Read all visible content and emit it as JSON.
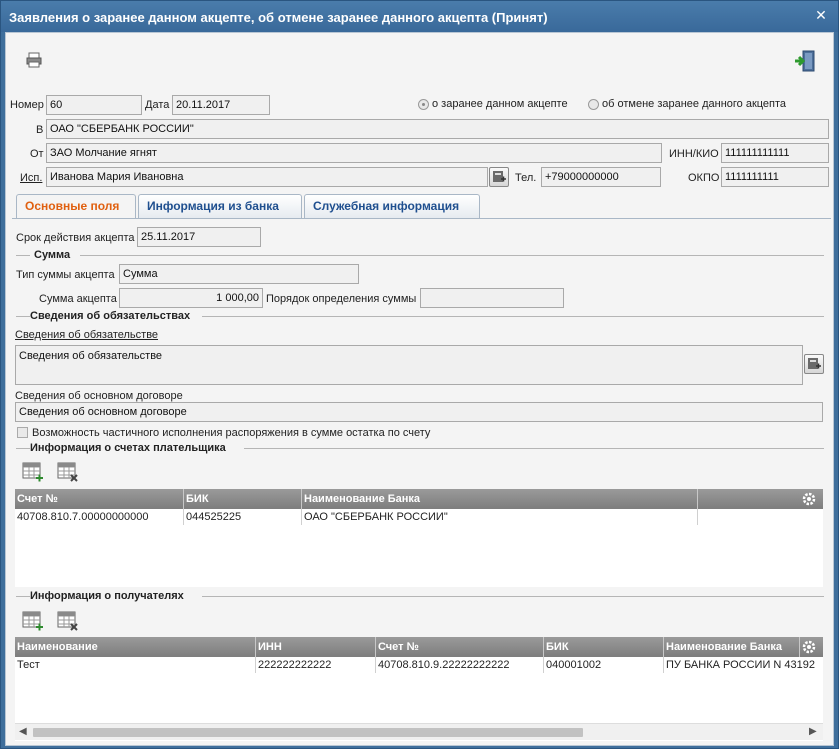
{
  "window": {
    "title": "Заявления о заранее данном акцепте, об отмене заранее данного акцепта (Принят)"
  },
  "header": {
    "number_label": "Номер",
    "number_value": "60",
    "date_label": "Дата",
    "date_value": "20.11.2017",
    "radio_advance": "о заранее данном акцепте",
    "radio_cancel": "об отмене заранее данного акцепта",
    "to_label": "В",
    "to_value": "ОАО \"СБЕРБАНК РОССИИ\"",
    "from_label": "От",
    "from_value": "ЗАО Молчание ягнят",
    "inn_label": "ИНН/КИО",
    "inn_value": "111111111111",
    "exec_label": "Исп.",
    "exec_value": "Иванова Мария Ивановна",
    "tel_label": "Тел.",
    "tel_value": "+79000000000",
    "okpo_label": "ОКПО",
    "okpo_value": "1111111111"
  },
  "tabs": [
    {
      "label": "Основные поля"
    },
    {
      "label": "Информация из банка"
    },
    {
      "label": "Служебная информация"
    }
  ],
  "main": {
    "term_label": "Срок действия акцепта",
    "term_value": "25.11.2017",
    "sum_section": "Сумма",
    "sum_type_label": "Тип суммы акцепта",
    "sum_type_value": "Сумма",
    "sum_label": "Сумма акцепта",
    "sum_value": "1 000,00",
    "order_label": "Порядок определения суммы",
    "order_value": "",
    "obligation_section": "Сведения об обязательствах",
    "obligation_link": "Сведения об обязательстве",
    "obligation_value": "Сведения об обязательстве",
    "contract_label": "Сведения об основном договоре",
    "contract_value": "Сведения об основном договоре",
    "partial_label": "Возможность частичного исполнения распоряжения в сумме остатка по счету",
    "accounts_section": "Информация о счетах плательщика",
    "recipients_section": "Информация о получателях"
  },
  "accounts_table": {
    "columns": [
      "Счет №",
      "БИК",
      "Наименование Банка"
    ],
    "rows": [
      [
        "40708.810.7.00000000000",
        "044525225",
        "ОАО \"СБЕРБАНК РОССИИ\""
      ]
    ]
  },
  "recipients_table": {
    "columns": [
      "Наименование",
      "ИНН",
      "Счет №",
      "БИК",
      "Наименование Банка"
    ],
    "rows": [
      [
        "Тест",
        "222222222222",
        "40708.810.9.22222222222",
        "040001002",
        "ПУ БАНКА РОССИИ N 43192"
      ]
    ]
  },
  "icons": {
    "print": "printer-icon",
    "exit": "exit-door-icon",
    "close": "close-icon",
    "dictionary": "dictionary-icon",
    "settings": "gear-icon",
    "add_row": "table-add-icon",
    "delete_row": "table-delete-icon"
  }
}
